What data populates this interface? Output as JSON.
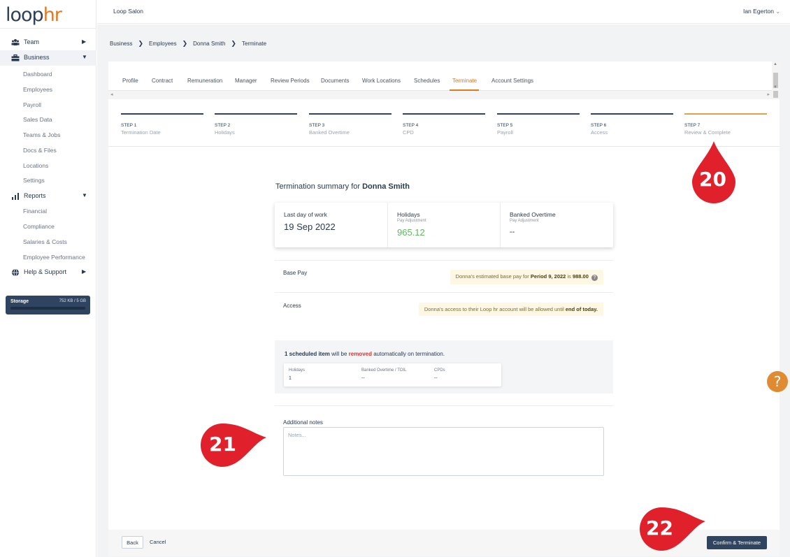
{
  "logo": {
    "part1": "loop",
    "part2": "hr"
  },
  "topbar": {
    "company": "Loop Salon",
    "user": "Ian Egerton",
    "user_chevron": "⌄"
  },
  "sidebar": {
    "groups": [
      {
        "label": "Team",
        "icon": "team-icon",
        "chevron": "▶"
      },
      {
        "label": "Business",
        "icon": "briefcase-icon",
        "chevron": "▼"
      },
      {
        "label": "Reports",
        "icon": "bar-chart-icon",
        "chevron": "▼"
      },
      {
        "label": "Help & Support",
        "icon": "globe-icon",
        "chevron": "▶"
      }
    ],
    "business_items": [
      "Dashboard",
      "Employees",
      "Payroll",
      "Sales Data",
      "Teams & Jobs",
      "Docs & Files",
      "Locations",
      "Settings"
    ],
    "report_items": [
      "Financial",
      "Compliance",
      "Salaries & Costs",
      "Employee Performance"
    ],
    "storage": {
      "label": "Storage",
      "value": "752 KB / 5 GB"
    }
  },
  "breadcrumb": [
    "Business",
    "Employees",
    "Donna Smith",
    "Terminate"
  ],
  "breadcrumb_sep": "❯",
  "tabs": [
    "Profile",
    "Contract",
    "Remuneration",
    "Manager",
    "Review Periods",
    "Documents",
    "Work Locations",
    "Schedules",
    "Terminate",
    "Account Settings"
  ],
  "active_tab": "Terminate",
  "steps": [
    {
      "num": "STEP 1",
      "name": "Termination Date"
    },
    {
      "num": "STEP 2",
      "name": "Holidays"
    },
    {
      "num": "STEP 3",
      "name": "Banked Overtime"
    },
    {
      "num": "STEP 4",
      "name": "CPD"
    },
    {
      "num": "STEP 5",
      "name": "Payroll"
    },
    {
      "num": "STEP 6",
      "name": "Access"
    },
    {
      "num": "STEP 7",
      "name": "Review & Complete"
    }
  ],
  "summary": {
    "title_prefix": "Termination summary for",
    "employee": "Donna Smith",
    "last_day_label": "Last day of work",
    "last_day_value": "19 Sep 2022",
    "holidays_label": "Holidays",
    "holidays_sub": "Pay Adjustment",
    "holidays_value": "965.12",
    "banked_label": "Banked Overtime",
    "banked_sub": "Pay Adjustment",
    "banked_value": "--",
    "positive_color": "#5cb85c"
  },
  "base_pay": {
    "label": "Base Pay",
    "text_pre": "Donna's estimated base pay for",
    "period": "Period 9, 2022",
    "text_mid": "is",
    "amount": "988.00"
  },
  "access": {
    "label": "Access",
    "text_pre": "Donna's access to their Loop hr account will be allowed until",
    "until": "end of today."
  },
  "scheduled": {
    "count_text": "1 scheduled item",
    "mid": "will be",
    "removed": "removed",
    "suffix": "automatically on termination.",
    "cells": [
      {
        "label": "Holidays",
        "value": "1"
      },
      {
        "label": "Banked Overtime / TOIL",
        "value": "--"
      },
      {
        "label": "CPDs",
        "value": "--"
      }
    ]
  },
  "notes": {
    "label": "Additional notes",
    "placeholder": "Notes..."
  },
  "footer": {
    "back": "Back",
    "cancel": "Cancel",
    "confirm": "Confirm & Terminate"
  },
  "help": "?",
  "markers": [
    {
      "num": "20"
    },
    {
      "num": "21"
    },
    {
      "num": "22"
    }
  ],
  "colors": {
    "accent": "#e07a22",
    "primary": "#2f4461",
    "marker": "#e0202a",
    "removed": "#d9332b"
  }
}
